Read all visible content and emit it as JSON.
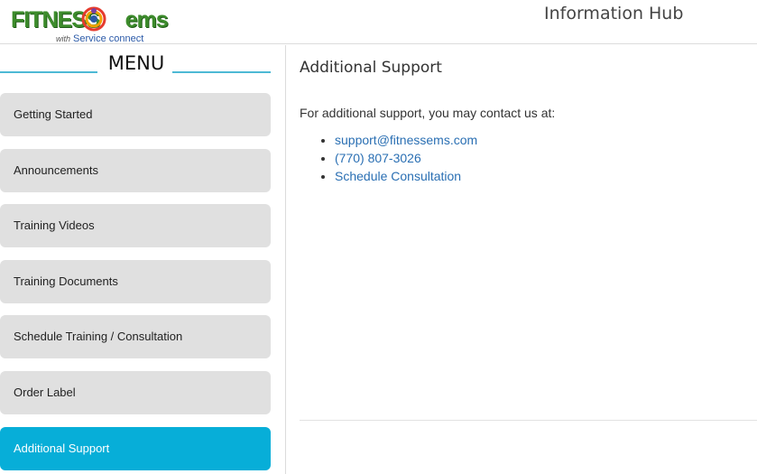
{
  "header": {
    "logo": {
      "word_fitness": "FITNESS",
      "word_ems": "ems",
      "tagline_with": "with",
      "tagline": "Service connect"
    },
    "title": "Information Hub"
  },
  "sidebar": {
    "heading": "MENU",
    "items": [
      {
        "label": "Getting Started",
        "active": false
      },
      {
        "label": "Announcements",
        "active": false
      },
      {
        "label": "Training Videos",
        "active": false
      },
      {
        "label": "Training Documents",
        "active": false
      },
      {
        "label": "Schedule Training / Consultation",
        "active": false
      },
      {
        "label": "Order Label",
        "active": false
      },
      {
        "label": "Additional Support",
        "active": true
      }
    ]
  },
  "main": {
    "title": "Additional Support",
    "intro": "For additional support, you may contact us at:",
    "contacts": [
      "support@fitnessems.com",
      "(770) 807-3026",
      "Schedule Consultation"
    ]
  },
  "colors": {
    "accent": "#07aed8",
    "menu_bg": "#e0e0e0",
    "link": "#2a6fb3",
    "brand_green": "#3d8c2c"
  }
}
